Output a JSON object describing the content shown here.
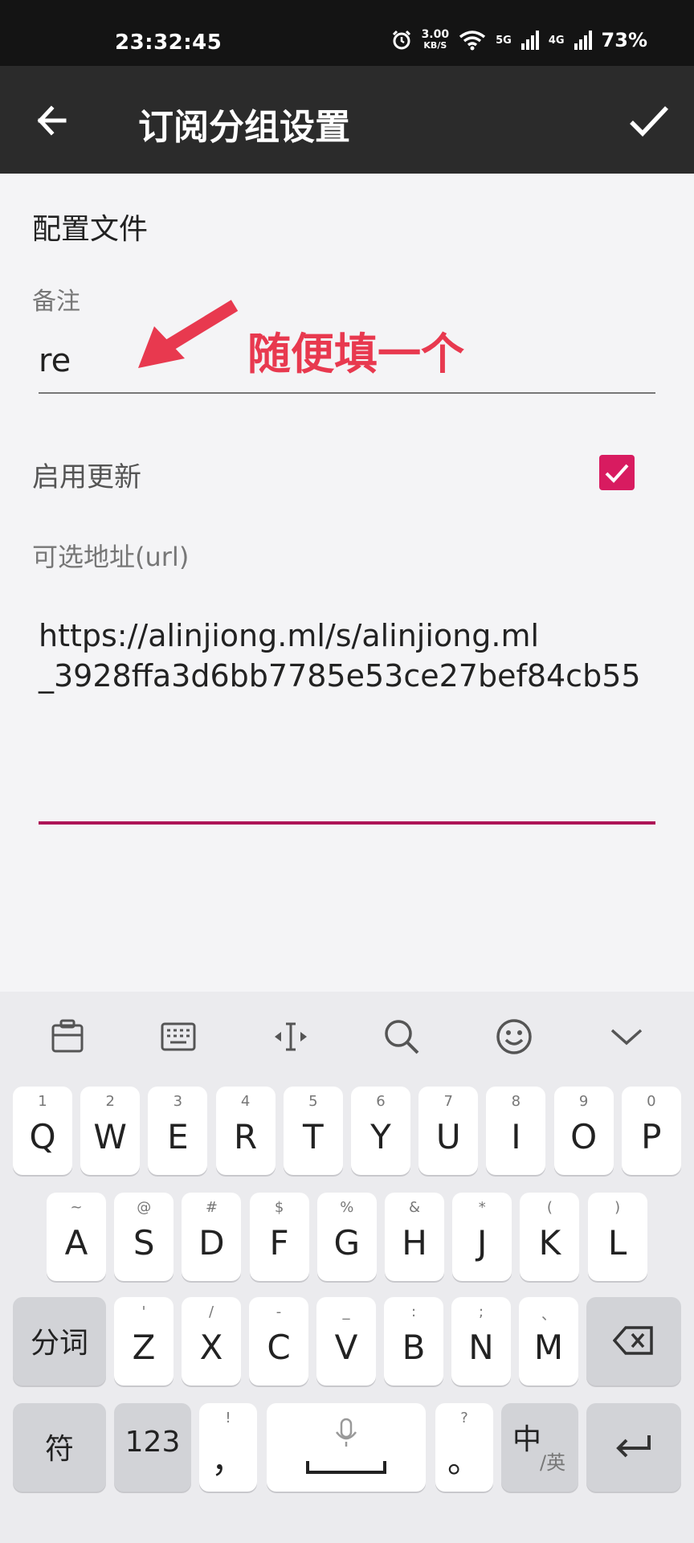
{
  "status_bar": {
    "time": "23:32:45",
    "speed_value": "3.00",
    "speed_unit": "KB/S",
    "net1": "5G",
    "net2": "4G",
    "battery": "73%"
  },
  "app_bar": {
    "title": "订阅分组设置",
    "back_icon": "arrow-left-icon",
    "confirm_icon": "check-icon"
  },
  "form": {
    "section_title": "配置文件",
    "remark_label": "备注",
    "remark_value": "re",
    "annotation": "随便填一个",
    "enable_update_label": "启用更新",
    "enable_update_checked": true,
    "url_label": "可选地址(url)",
    "url_value": "https://alinjiong.ml/s/alinjiong.ml\n_3928ffa3d6bb7785e53ce27bef84cb55"
  },
  "keyboard": {
    "toolbar_icons": [
      "clipboard-icon",
      "keyboard-icon",
      "cursor-move-icon",
      "search-icon",
      "emoji-icon",
      "chevron-down-icon"
    ],
    "row1": [
      {
        "sub": "1",
        "main": "Q"
      },
      {
        "sub": "2",
        "main": "W"
      },
      {
        "sub": "3",
        "main": "E"
      },
      {
        "sub": "4",
        "main": "R"
      },
      {
        "sub": "5",
        "main": "T"
      },
      {
        "sub": "6",
        "main": "Y"
      },
      {
        "sub": "7",
        "main": "U"
      },
      {
        "sub": "8",
        "main": "I"
      },
      {
        "sub": "9",
        "main": "O"
      },
      {
        "sub": "0",
        "main": "P"
      }
    ],
    "row2": [
      {
        "sub": "~",
        "main": "A"
      },
      {
        "sub": "@",
        "main": "S"
      },
      {
        "sub": "#",
        "main": "D"
      },
      {
        "sub": "$",
        "main": "F"
      },
      {
        "sub": "%",
        "main": "G"
      },
      {
        "sub": "&",
        "main": "H"
      },
      {
        "sub": "*",
        "main": "J"
      },
      {
        "sub": "(",
        "main": "K"
      },
      {
        "sub": ")",
        "main": "L"
      }
    ],
    "row3_left": "分词",
    "row3": [
      {
        "sub": "'",
        "main": "Z"
      },
      {
        "sub": "/",
        "main": "X"
      },
      {
        "sub": "-",
        "main": "C"
      },
      {
        "sub": "_",
        "main": "V"
      },
      {
        "sub": ":",
        "main": "B"
      },
      {
        "sub": ";",
        "main": "N"
      },
      {
        "sub": "、",
        "main": "M"
      }
    ],
    "row4": {
      "symbols": "符",
      "numbers": "123",
      "comma_sub": "!",
      "comma_main": "，",
      "period_sub": "?",
      "period_main": "。",
      "lang_main": "中",
      "lang_sub": "/英"
    }
  }
}
